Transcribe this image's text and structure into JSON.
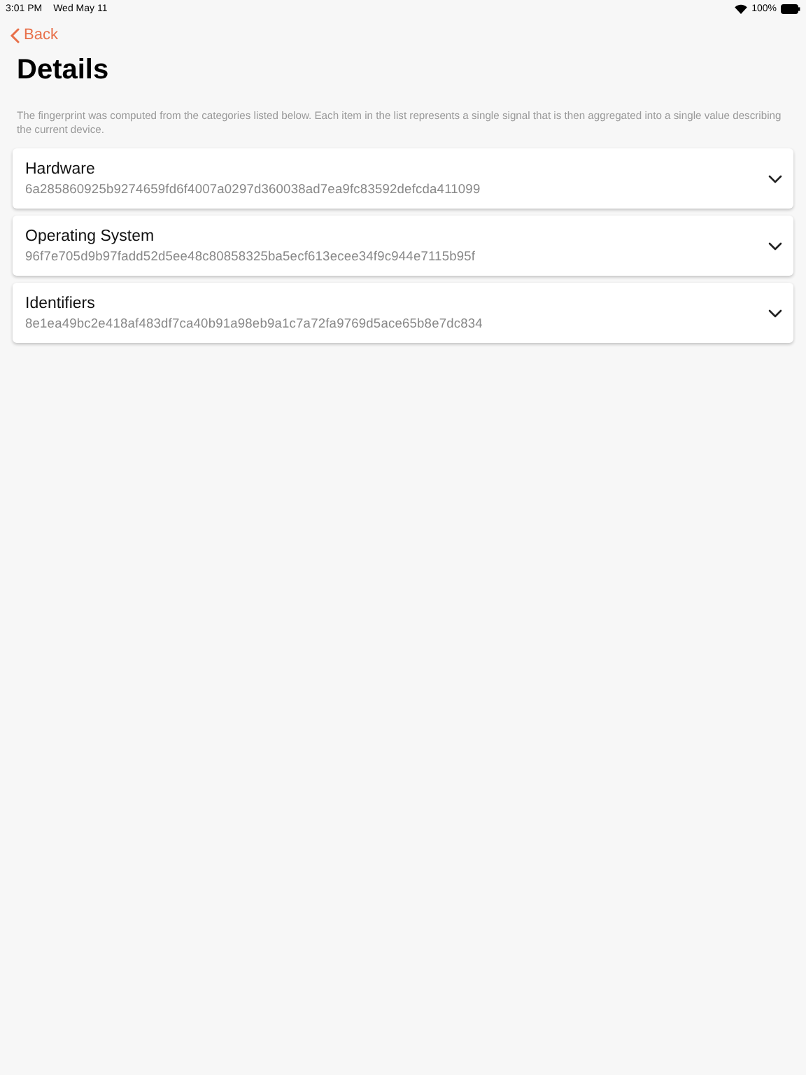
{
  "status_bar": {
    "time": "3:01 PM",
    "date": "Wed May 11",
    "battery": "100%"
  },
  "nav": {
    "back": "Back"
  },
  "title": "Details",
  "description": "The fingerprint was computed from the categories listed below. Each item in the list represents a single signal that is then aggregated into a single value describing the current device.",
  "categories": [
    {
      "name": "Hardware",
      "hash": "6a285860925b9274659fd6f4007a0297d360038ad7ea9fc83592defcda411099",
      "expanded": false
    },
    {
      "name": "Operating System",
      "hash": "96f7e705d9b97fadd52d5ee48c80858325ba5ecf613ecee34f9c944e7115b95f",
      "expanded": false
    },
    {
      "name": "Identifiers",
      "hash": "8e1ea49bc2e418af483df7ca40b91a98eb9a1c7a72fa9769d5ace65b8e7dc834",
      "expanded": false
    }
  ]
}
